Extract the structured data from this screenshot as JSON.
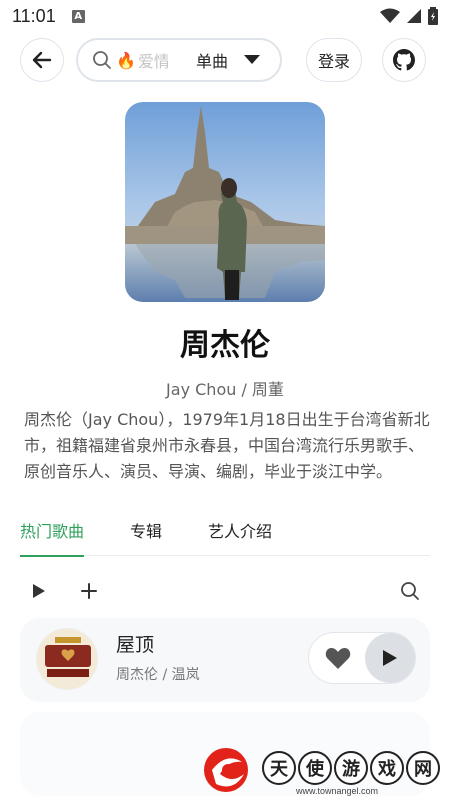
{
  "status_bar": {
    "time": "11:01",
    "notif_icon": "A"
  },
  "top_bar": {
    "search_placeholder": "爱情",
    "search_type": "单曲",
    "login_label": "登录"
  },
  "artist": {
    "name": "周杰伦",
    "alias": "Jay Chou / 周董",
    "bio": "周杰伦（Jay Chou），1979年1月18日出生于台湾省新北市，祖籍福建省泉州市永春县，中国台湾流行乐男歌手、原创音乐人、演员、导演、编剧，毕业于淡江中学。"
  },
  "tabs": [
    {
      "label": "热门歌曲",
      "active": true
    },
    {
      "label": "专辑",
      "active": false
    },
    {
      "label": "艺人介绍",
      "active": false
    }
  ],
  "songs": [
    {
      "title": "屋顶",
      "artists": "周杰伦 / 温岚"
    }
  ],
  "watermark": {
    "chars": [
      "天",
      "使",
      "游",
      "戏",
      "网"
    ],
    "url": "www.townangel.com"
  },
  "colors": {
    "accent": "#2fa05b",
    "border": "#dfe3ea"
  }
}
